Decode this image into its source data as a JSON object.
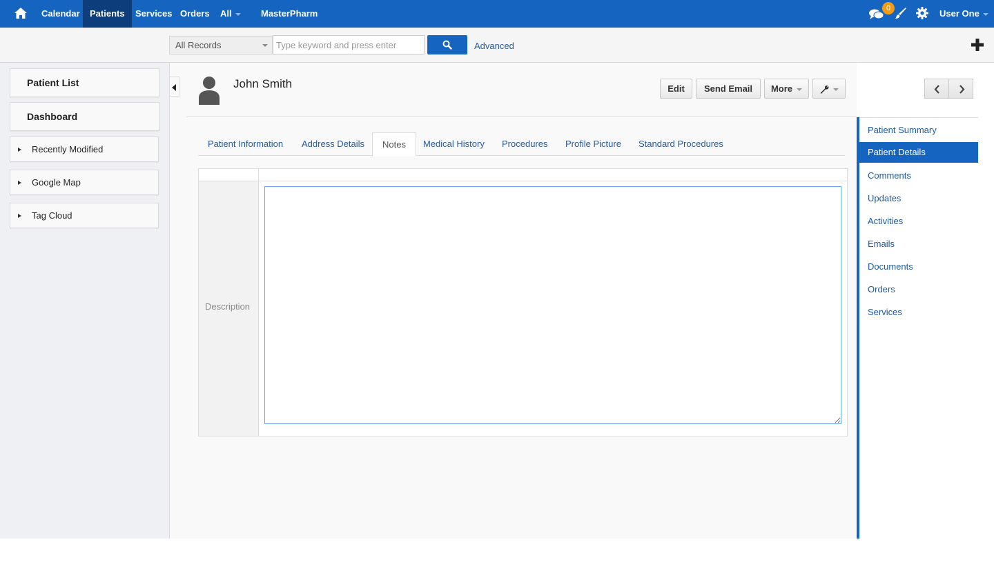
{
  "topnav": {
    "items": [
      "Calendar",
      "Patients",
      "Services",
      "Orders",
      "All"
    ],
    "brand": "MasterPharm",
    "notification_count": "0",
    "user": "User One"
  },
  "search": {
    "scope": "All Records",
    "placeholder": "Type keyword and press enter",
    "advanced": "Advanced"
  },
  "leftnav": {
    "patient_list": "Patient List",
    "dashboard": "Dashboard",
    "sections": [
      "Recently Modified",
      "Google Map",
      "Tag Cloud"
    ]
  },
  "record": {
    "name": "John Smith",
    "actions": {
      "edit": "Edit",
      "send_email": "Send Email",
      "more": "More"
    }
  },
  "tabs": [
    "Patient Information",
    "Address Details",
    "Notes",
    "Medical History",
    "Procedures",
    "Profile Picture",
    "Standard Procedures"
  ],
  "form": {
    "description_label": "Description",
    "description_value": ""
  },
  "rightnav": [
    "Patient Summary",
    "Patient Details",
    "Comments",
    "Updates",
    "Activities",
    "Emails",
    "Documents",
    "Orders",
    "Services"
  ],
  "colors": {
    "primary": "#1565c0",
    "active_nav": "#0d3d7a",
    "badge": "#f39c12",
    "link": "#2a5a94"
  }
}
